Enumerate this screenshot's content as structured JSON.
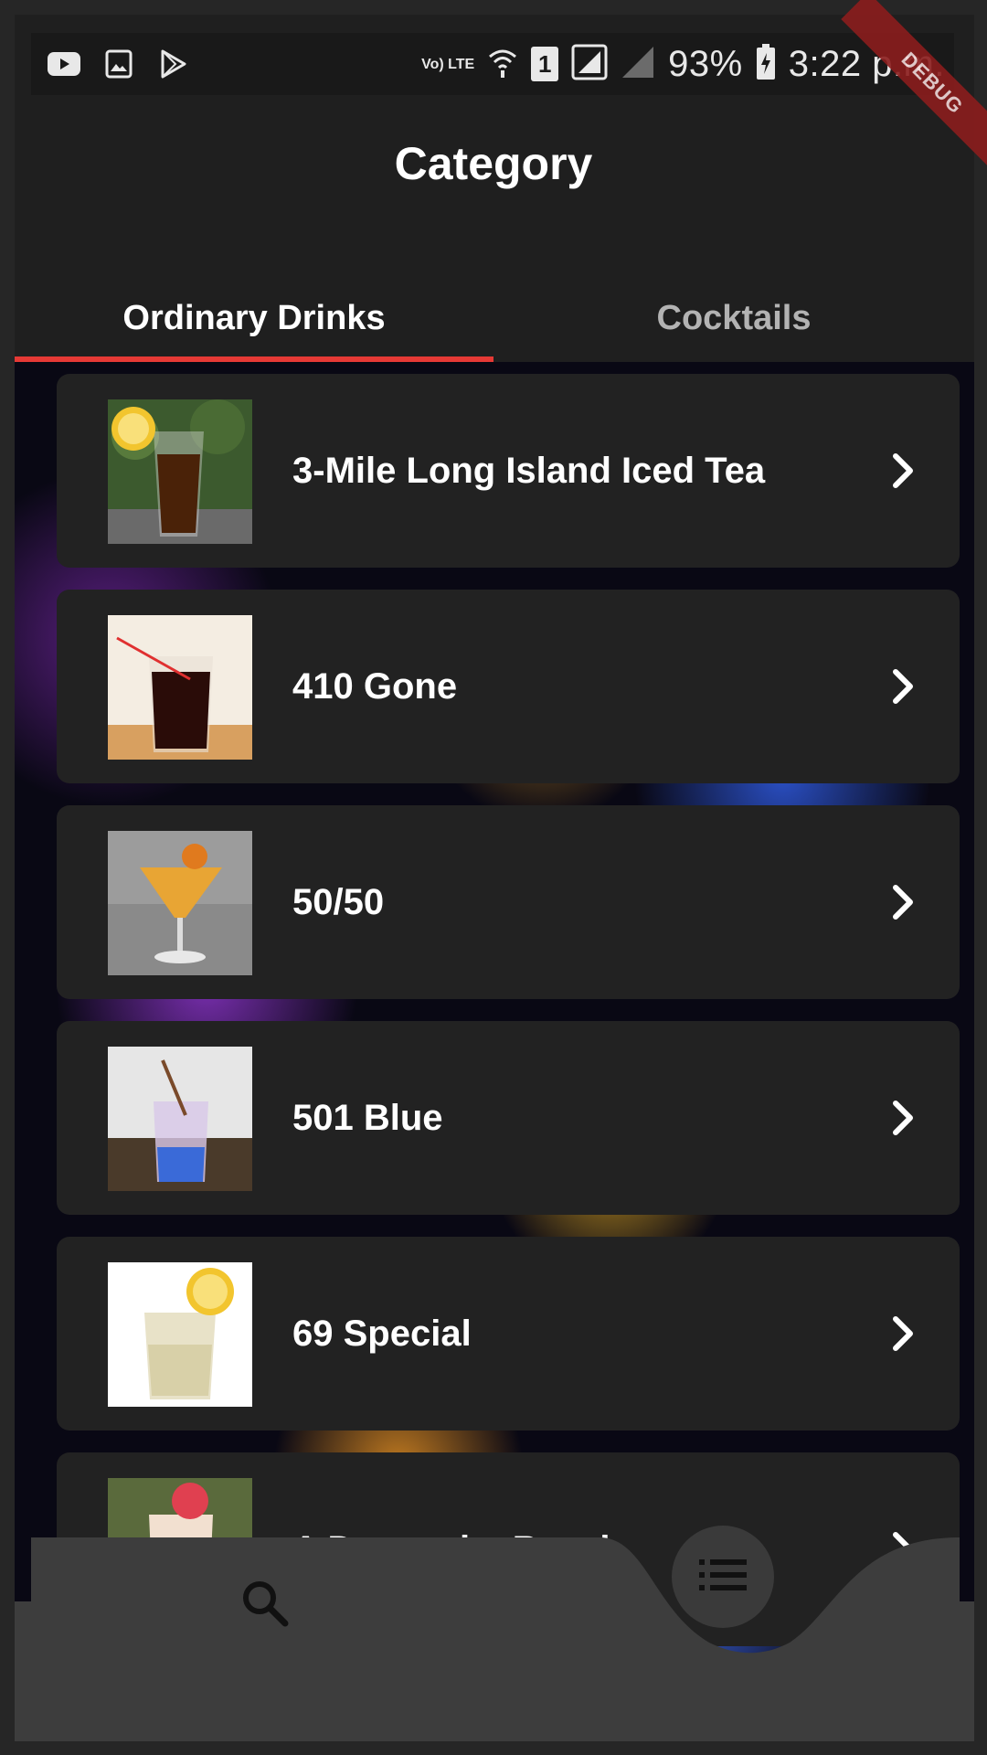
{
  "status_bar": {
    "left_icons": [
      "youtube-icon",
      "gallery-icon",
      "play-store-icon"
    ],
    "network": "Vo) LTE",
    "sim_slot": "1",
    "battery": "93%",
    "time": "3:22 p.m."
  },
  "debug_banner": "DEBUG",
  "app_bar": {
    "title": "Category"
  },
  "tabs": [
    {
      "label": "Ordinary Drinks",
      "selected": true
    },
    {
      "label": "Cocktails",
      "selected": false
    }
  ],
  "drinks": [
    {
      "name": "3-Mile Long Island Iced Tea"
    },
    {
      "name": "410 Gone"
    },
    {
      "name": "50/50"
    },
    {
      "name": "501 Blue"
    },
    {
      "name": "69 Special"
    },
    {
      "name": "A Day at the Beach"
    }
  ],
  "bottom_nav": {
    "items": [
      {
        "icon": "search-icon"
      },
      {
        "icon": "list-icon"
      }
    ]
  },
  "colors": {
    "tab_indicator": "#e53935",
    "card_background": "#222222",
    "debug_ribbon": "#8b1d1d"
  }
}
